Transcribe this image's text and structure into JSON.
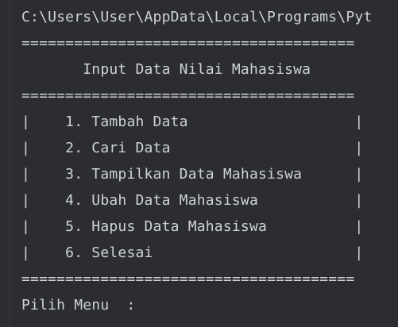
{
  "console": {
    "path": "C:\\Users\\User\\AppData\\Local\\Programs\\Pyt",
    "separator": "======================================",
    "title": "       Input Data Nilai Mahasiswa",
    "menu": [
      "|    1. Tambah Data                   |",
      "|    2. Cari Data                     |",
      "|    3. Tampilkan Data Mahasiswa      |",
      "|    4. Ubah Data Mahasiswa           |",
      "|    5. Hapus Data Mahasiswa          |",
      "|    6. Selesai                       |"
    ],
    "prompt": "Pilih Menu  :"
  },
  "colors": {
    "background": "#2b2d30",
    "text": "#cfd2d6"
  }
}
